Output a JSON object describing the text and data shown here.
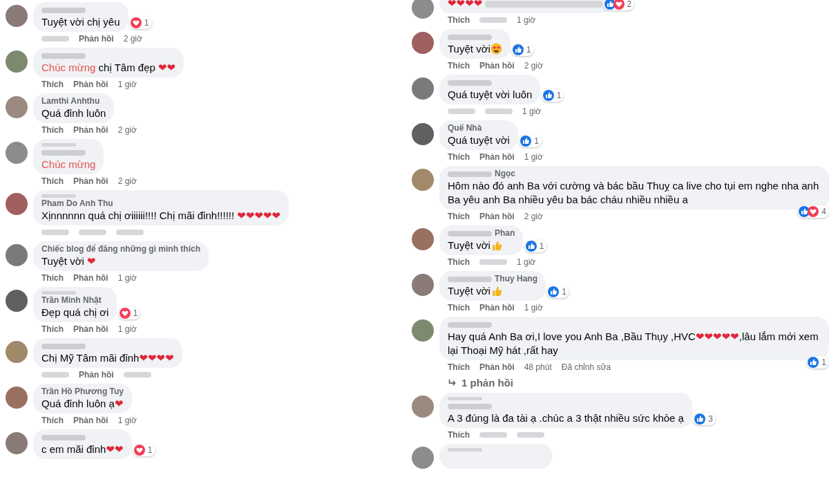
{
  "columns": [
    {
      "comments": [
        {
          "header": [
            {
              "kind": "hidden-name"
            }
          ],
          "segments": [
            {
              "kind": "text",
              "text": "Tuyệt vời chị yêu"
            }
          ],
          "reactions": {
            "icons": [
              {
                "kind": "love"
              }
            ],
            "count": "1"
          },
          "actions": [
            {
              "kind": "hidden"
            },
            {
              "kind": "reply",
              "label": "Phản hồi"
            },
            {
              "kind": "time",
              "label": "2 giờ"
            }
          ]
        },
        {
          "header": [
            {
              "kind": "hidden-name"
            }
          ],
          "segments": [
            {
              "kind": "highlight",
              "text": "Chúc mừng"
            },
            {
              "kind": "text",
              "text": " chị Tâm đẹp "
            },
            {
              "kind": "hearts",
              "text": "❤❤"
            }
          ],
          "actions": [
            {
              "kind": "like",
              "label": "Thích"
            },
            {
              "kind": "reply",
              "label": "Phản hồi"
            },
            {
              "kind": "time",
              "label": "1 giờ"
            }
          ]
        },
        {
          "header": [
            {
              "kind": "name",
              "text": "Lamthi Anhthu"
            }
          ],
          "segments": [
            {
              "kind": "text",
              "text": "Quá đỉnh luôn"
            }
          ],
          "actions": [
            {
              "kind": "like",
              "label": "Thích"
            },
            {
              "kind": "reply",
              "label": "Phản hồi"
            },
            {
              "kind": "time",
              "label": "2 giờ"
            }
          ]
        },
        {
          "header": [
            {
              "kind": "hidden-badge"
            },
            {
              "kind": "hidden-name"
            }
          ],
          "segments": [
            {
              "kind": "highlight",
              "text": "Chúc mừng"
            }
          ],
          "actions": [
            {
              "kind": "like",
              "label": "Thích"
            },
            {
              "kind": "reply",
              "label": "Phản hồi"
            },
            {
              "kind": "time",
              "label": "2 giờ"
            }
          ]
        },
        {
          "header": [
            {
              "kind": "hidden-badge"
            },
            {
              "kind": "name",
              "text": "Pham Do Anh Thu"
            }
          ],
          "segments": [
            {
              "kind": "text",
              "text": "Xịnnnnnn quá chị ơiiiiii!!!! Chị mãi đỉnh!!!!!! "
            },
            {
              "kind": "hearts",
              "text": "❤❤❤❤❤"
            }
          ],
          "actions": [
            {
              "kind": "hidden"
            },
            {
              "kind": "hidden"
            },
            {
              "kind": "hidden"
            }
          ]
        },
        {
          "header": [
            {
              "kind": "name",
              "text": "Chiếc blog để đăng những gì mình thích"
            }
          ],
          "segments": [
            {
              "kind": "text",
              "text": "Tuyệt vời "
            },
            {
              "kind": "hearts",
              "text": "❤"
            }
          ],
          "actions": [
            {
              "kind": "like",
              "label": "Thích"
            },
            {
              "kind": "reply",
              "label": "Phản hồi"
            },
            {
              "kind": "time",
              "label": "1 giờ"
            }
          ]
        },
        {
          "header": [
            {
              "kind": "hidden-badge"
            },
            {
              "kind": "name",
              "text": "Trần Minh Nhật"
            }
          ],
          "segments": [
            {
              "kind": "text",
              "text": "Đẹp quá chị ơi"
            }
          ],
          "reactions": {
            "icons": [
              {
                "kind": "love"
              }
            ],
            "count": "1"
          },
          "actions": [
            {
              "kind": "like",
              "label": "Thích"
            },
            {
              "kind": "reply",
              "label": "Phản hồi"
            },
            {
              "kind": "time",
              "label": "1 giờ"
            }
          ]
        },
        {
          "header": [
            {
              "kind": "hidden-name"
            }
          ],
          "segments": [
            {
              "kind": "text",
              "text": "Chị Mỹ Tâm mãi đỉnh"
            },
            {
              "kind": "hearts",
              "text": "❤❤❤❤"
            }
          ],
          "actions": [
            {
              "kind": "hidden"
            },
            {
              "kind": "reply",
              "label": "Phản hồi"
            },
            {
              "kind": "hidden"
            }
          ]
        },
        {
          "header": [
            {
              "kind": "name",
              "text": "Trần Hồ Phương Tuy"
            }
          ],
          "segments": [
            {
              "kind": "text",
              "text": "Quá đỉnh luôn ạ"
            },
            {
              "kind": "hearts",
              "text": "❤"
            }
          ],
          "actions": [
            {
              "kind": "like",
              "label": "Thích"
            },
            {
              "kind": "reply",
              "label": "Phản hồi"
            },
            {
              "kind": "time",
              "label": "1 giờ"
            }
          ]
        },
        {
          "header": [
            {
              "kind": "hidden-name"
            }
          ],
          "segments": [
            {
              "kind": "text",
              "text": "c em mãi đỉnh"
            },
            {
              "kind": "hearts",
              "text": "❤❤"
            }
          ],
          "reactions": {
            "icons": [
              {
                "kind": "love"
              }
            ],
            "count": "1"
          }
        }
      ]
    },
    {
      "comments": [
        {
          "segments": [
            {
              "kind": "hearts",
              "text": "❤❤❤❤"
            },
            {
              "kind": "blurred"
            }
          ],
          "reactions": {
            "icons": [
              {
                "kind": "like"
              },
              {
                "kind": "love"
              }
            ],
            "count": "2"
          },
          "actions": [
            {
              "kind": "like",
              "label": "Thích"
            },
            {
              "kind": "hidden"
            },
            {
              "kind": "time",
              "label": "1 giờ"
            }
          ]
        },
        {
          "header": [
            {
              "kind": "hidden-name"
            }
          ],
          "segments": [
            {
              "kind": "text",
              "text": "Tuyệt vời"
            },
            {
              "kind": "heart-eyes-emoji"
            }
          ],
          "reactions": {
            "icons": [
              {
                "kind": "like"
              }
            ],
            "count": "1"
          },
          "actions": [
            {
              "kind": "like",
              "label": "Thích"
            },
            {
              "kind": "reply",
              "label": "Phản hồi"
            },
            {
              "kind": "time",
              "label": "2 giờ"
            }
          ]
        },
        {
          "header": [
            {
              "kind": "hidden-name"
            }
          ],
          "segments": [
            {
              "kind": "text",
              "text": "Quá tuyệt vời luôn"
            }
          ],
          "reactions": {
            "icons": [
              {
                "kind": "like"
              }
            ],
            "count": "1"
          },
          "actions": [
            {
              "kind": "hidden"
            },
            {
              "kind": "hidden"
            },
            {
              "kind": "time",
              "label": "1 giờ"
            }
          ]
        },
        {
          "header": [
            {
              "kind": "name",
              "text": "Quế Nhà"
            }
          ],
          "segments": [
            {
              "kind": "text",
              "text": "Quá tuyệt vời"
            }
          ],
          "reactions": {
            "icons": [
              {
                "kind": "like"
              }
            ],
            "count": "1"
          },
          "actions": [
            {
              "kind": "like",
              "label": "Thích"
            },
            {
              "kind": "reply",
              "label": "Phản hồi"
            },
            {
              "kind": "time",
              "label": "1 giờ"
            }
          ]
        },
        {
          "header": [
            {
              "kind": "hidden-name"
            },
            {
              "kind": "name",
              "text": "Ngọc"
            }
          ],
          "segments": [
            {
              "kind": "text",
              "text": "Hôm nào đó anh Ba với cường và bác bầu Thuỵ ca live cho tụi em nghe nha anh Ba yêu anh Ba nhiều yêu ba bác cháu nhiều nhiều a"
            }
          ],
          "reactions": {
            "icons": [
              {
                "kind": "like"
              },
              {
                "kind": "love"
              }
            ],
            "count": "4"
          },
          "actions": [
            {
              "kind": "like",
              "label": "Thích"
            },
            {
              "kind": "reply",
              "label": "Phản hồi"
            },
            {
              "kind": "time",
              "label": "2 giờ"
            }
          ]
        },
        {
          "header": [
            {
              "kind": "hidden-name"
            },
            {
              "kind": "name",
              "text": "Phan"
            }
          ],
          "segments": [
            {
              "kind": "text",
              "text": "Tuyệt vời"
            },
            {
              "kind": "thumb-emoji"
            }
          ],
          "reactions": {
            "icons": [
              {
                "kind": "like"
              }
            ],
            "count": "1"
          },
          "actions": [
            {
              "kind": "like",
              "label": "Thích"
            },
            {
              "kind": "hidden"
            },
            {
              "kind": "time",
              "label": "1 giờ"
            }
          ]
        },
        {
          "header": [
            {
              "kind": "hidden-name"
            },
            {
              "kind": "name",
              "text": "Thuy Hang"
            }
          ],
          "segments": [
            {
              "kind": "text",
              "text": "Tuyệt vời"
            },
            {
              "kind": "thumb-emoji"
            }
          ],
          "reactions": {
            "icons": [
              {
                "kind": "like"
              }
            ],
            "count": "1"
          },
          "actions": [
            {
              "kind": "like",
              "label": "Thích"
            },
            {
              "kind": "reply",
              "label": "Phản hồi"
            },
            {
              "kind": "time",
              "label": "1 giờ"
            }
          ]
        },
        {
          "header": [
            {
              "kind": "hidden-name"
            }
          ],
          "segments": [
            {
              "kind": "text",
              "text": "Hay quá Anh Ba ơi,I love you Anh Ba ,Bầu Thụy ,HVC"
            },
            {
              "kind": "hearts",
              "text": "❤❤❤❤❤"
            },
            {
              "kind": "text",
              "text": ",lâu lắm mới xem lại Thoại Mỹ hát ,rất hay"
            }
          ],
          "reactions": {
            "icons": [
              {
                "kind": "like"
              }
            ],
            "count": "1"
          },
          "actions": [
            {
              "kind": "like",
              "label": "Thích"
            },
            {
              "kind": "reply",
              "label": "Phản hồi"
            },
            {
              "kind": "time",
              "label": "48 phút"
            },
            {
              "kind": "edited",
              "label": "Đã chỉnh sửa"
            }
          ],
          "replies_link": "1 phản hồi"
        },
        {
          "header": [
            {
              "kind": "hidden-badge"
            },
            {
              "kind": "hidden-name"
            }
          ],
          "segments": [
            {
              "kind": "text",
              "text": "A 3 đúng là đa tài ạ .chúc a 3 thật nhiều sức khỏe ạ"
            }
          ],
          "reactions": {
            "icons": [
              {
                "kind": "like"
              }
            ],
            "count": "3"
          },
          "actions": [
            {
              "kind": "like",
              "label": "Thích"
            },
            {
              "kind": "hidden"
            },
            {
              "kind": "hidden"
            }
          ]
        },
        {
          "header": [
            {
              "kind": "hidden-badge"
            }
          ]
        }
      ]
    }
  ]
}
